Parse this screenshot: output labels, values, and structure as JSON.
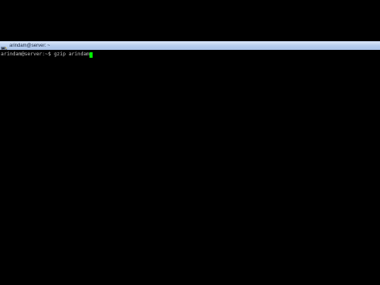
{
  "window": {
    "title": "arindam@server: ~",
    "icon": "putty-terminal-icon"
  },
  "terminal": {
    "prompt": "arindam@server:~$ ",
    "command": "gzip arindam",
    "cursor_color": "#00ee00",
    "text_color": "#c0c0c0",
    "background": "#000000"
  }
}
